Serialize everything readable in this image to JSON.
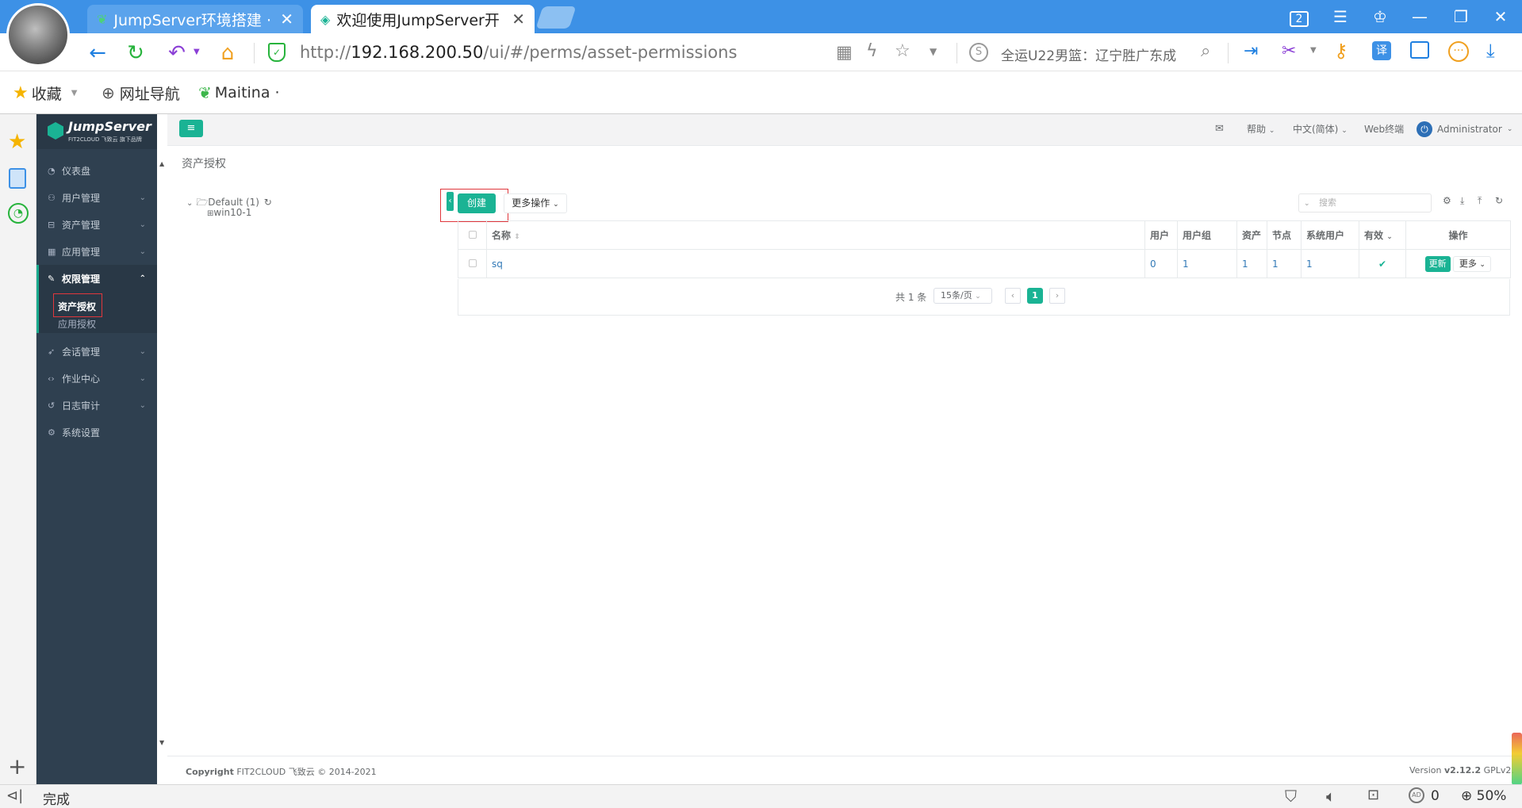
{
  "browser": {
    "tabs": [
      {
        "title": "JumpServer环境搭建 · ",
        "active": false
      },
      {
        "title": "欢迎使用JumpServer开",
        "active": true
      }
    ],
    "tab_counter": "2",
    "url_scheme": "http://",
    "url_host": "192.168.200.50",
    "url_path": "/ui/#/perms/asset-permissions",
    "search_text": "全运U22男篮：辽宁胜广东成",
    "bookmarks": [
      {
        "label": "收藏"
      },
      {
        "label": "网址导航"
      },
      {
        "label": "Maitina ·"
      }
    ],
    "status_text": "完成",
    "status_count": "0",
    "zoom": "50%"
  },
  "app": {
    "logo_title": "JumpServer",
    "logo_subtitle": "FIT2CLOUD 飞致云  旗下品牌",
    "menu": [
      {
        "label": "仪表盘",
        "has_children": false
      },
      {
        "label": "用户管理",
        "has_children": true
      },
      {
        "label": "资产管理",
        "has_children": true
      },
      {
        "label": "应用管理",
        "has_children": true
      },
      {
        "label": "权限管理",
        "has_children": true,
        "open": true
      },
      {
        "label": "会话管理",
        "has_children": true
      },
      {
        "label": "作业中心",
        "has_children": true
      },
      {
        "label": "日志审计",
        "has_children": true
      },
      {
        "label": "系统设置",
        "has_children": false
      }
    ],
    "submenu": [
      {
        "label": "资产授权",
        "active": true
      },
      {
        "label": "应用授权",
        "active": false
      }
    ],
    "header": {
      "help": "帮助",
      "language": "中文(简体)",
      "web_terminal": "Web终端",
      "user": "Administrator"
    },
    "breadcrumb": "资产授权",
    "tree": {
      "root": "Default (1)",
      "child": "win10-1"
    },
    "toolbar": {
      "create": "创建",
      "more_actions": "更多操作",
      "search_placeholder": "搜索"
    },
    "table": {
      "columns": [
        "名称",
        "用户",
        "用户组",
        "资产",
        "节点",
        "系统用户",
        "有效",
        "操作"
      ],
      "rows": [
        {
          "name": "sq",
          "users": "0",
          "user_groups": "1",
          "assets": "1",
          "nodes": "1",
          "system_users": "1",
          "valid": true,
          "update": "更新",
          "more": "更多"
        }
      ]
    },
    "pagination": {
      "total": "共 1 条",
      "page_size": "15条/页",
      "current_page": "1"
    },
    "footer": {
      "copyright_label": "Copyright",
      "copyright_text": "FIT2CLOUD 飞致云 © 2014-2021",
      "version_label": "Version",
      "version": "v2.12.2",
      "license": "GPLv2."
    }
  },
  "colors": {
    "browser_tabbar": "#3d91e6",
    "sidebar": "#2f4050",
    "primary": "#1ab394",
    "link": "#337ab7",
    "highlight_box": "#e0373c"
  }
}
